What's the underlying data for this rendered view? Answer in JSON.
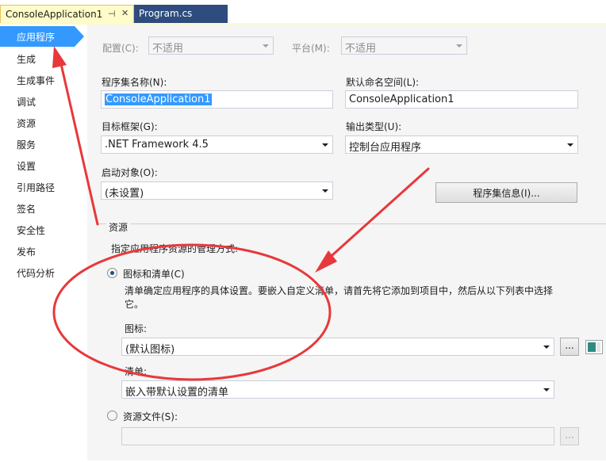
{
  "tabs": {
    "active_label": "ConsoleApplication1",
    "pin_glyph": "⊣",
    "close_glyph": "✕",
    "other_label": "Program.cs"
  },
  "sidebar": {
    "items": [
      {
        "label": "应用程序"
      },
      {
        "label": "生成"
      },
      {
        "label": "生成事件"
      },
      {
        "label": "调试"
      },
      {
        "label": "资源"
      },
      {
        "label": "服务"
      },
      {
        "label": "设置"
      },
      {
        "label": "引用路径"
      },
      {
        "label": "签名"
      },
      {
        "label": "安全性"
      },
      {
        "label": "发布"
      },
      {
        "label": "代码分析"
      }
    ]
  },
  "config": {
    "config_label": "配置(C):",
    "config_value": "不适用",
    "platform_label": "平台(M):",
    "platform_value": "不适用"
  },
  "app": {
    "assembly_name_label": "程序集名称(N):",
    "assembly_name_value": "ConsoleApplication1",
    "namespace_label": "默认命名空间(L):",
    "namespace_value": "ConsoleApplication1",
    "framework_label": "目标框架(G):",
    "framework_value": ".NET Framework 4.5",
    "output_type_label": "输出类型(U):",
    "output_type_value": "控制台应用程序",
    "startup_label": "启动对象(O):",
    "startup_value": "(未设置)",
    "assembly_info_button": "程序集信息(I)..."
  },
  "resources": {
    "group_title": "资源",
    "intro": "指定应用程序资源的管理方式:",
    "radio_icon_manifest": "图标和清单(C)",
    "description": "清单确定应用程序的具体设置。要嵌入自定义清单，请首先将它添加到项目中，然后从以下列表中选择它。",
    "icon_label": "图标:",
    "icon_value": "(默认图标)",
    "browse_button": "...",
    "manifest_label": "清单:",
    "manifest_value": "嵌入带默认设置的清单",
    "radio_resource_file": "资源文件(S):",
    "resource_file_value": "",
    "resource_browse_button": "..."
  },
  "annotation": {
    "color": "#e8383b"
  },
  "icons": {
    "dropdown": "chevron-down-icon",
    "radio": "radio-button-icon",
    "preview": "icon-preview"
  }
}
